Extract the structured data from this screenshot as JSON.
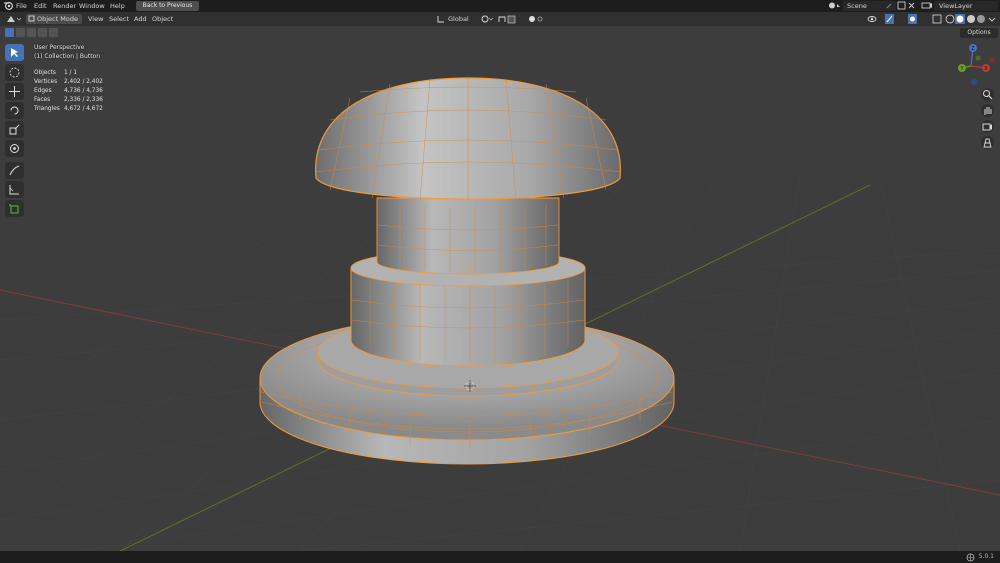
{
  "topbar": {
    "menu": [
      "File",
      "Edit",
      "Render",
      "Window",
      "Help"
    ],
    "back_button": "Back to Previous",
    "scene_name": "Scene",
    "view_layer": "ViewLayer"
  },
  "header": {
    "mode": "Object Mode",
    "menus": [
      "View",
      "Select",
      "Add",
      "Object"
    ],
    "transform_orientation": "Global"
  },
  "viewport": {
    "title": "User Perspective",
    "collection": "(1) Collection | Button",
    "options_label": "Options",
    "stats": [
      {
        "label": "Objects",
        "value": "1 / 1"
      },
      {
        "label": "Vertices",
        "value": "2,402 / 2,402"
      },
      {
        "label": "Edges",
        "value": "4,736 / 4,736"
      },
      {
        "label": "Faces",
        "value": "2,336 / 2,336"
      },
      {
        "label": "Triangles",
        "value": "4,672 / 4,672"
      }
    ],
    "gizmo_axes": [
      "Z",
      "Y",
      "X"
    ]
  },
  "tools": [
    "select-box-icon",
    "cursor-icon",
    "move-icon",
    "rotate-icon",
    "scale-icon",
    "transform-icon",
    "annotate-icon",
    "measure-icon",
    "add-cube-icon"
  ],
  "nav_icons": [
    "zoom-icon",
    "pan-hand-icon",
    "camera-icon",
    "grid-ortho-icon"
  ],
  "status": {
    "version": "5.0.1"
  },
  "colors": {
    "accent": "#4772b3",
    "selection_outline": "#f29a38",
    "background": "#3d3d3d"
  }
}
